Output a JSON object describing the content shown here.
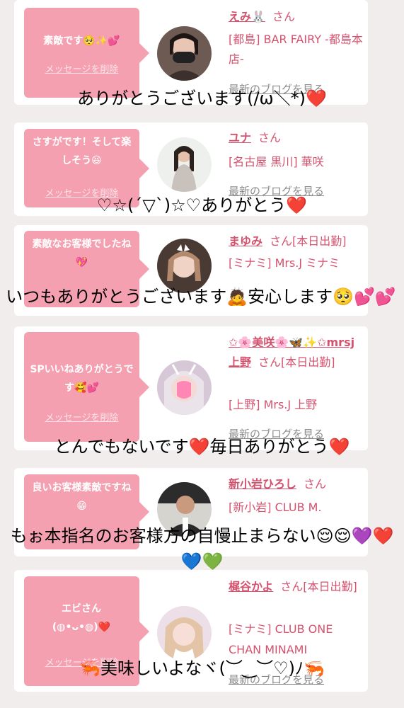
{
  "cards": [
    {
      "message": "素敵です🥺✨💕",
      "delete_label": "メッセージを削除",
      "name": "えみ🐰",
      "honorific": "さん",
      "shop": "[都島] BAR FAIRY -都島本店-",
      "blog_label": "最新のブログを見る"
    },
    {
      "message": "さすがです！そして楽しそう😆",
      "delete_label": "メッセージを削除",
      "name": "ユナ",
      "honorific": "さん",
      "shop": "[名古屋 黒川] 華咲",
      "blog_label": "最新のブログを見る"
    },
    {
      "message": "素敵なお客様でしたね💖",
      "delete_label": "メッセージを削除",
      "name": "まゆみ",
      "honorific": "さん[本日出勤]",
      "shop": "[ミナミ] Mrs.J ミナミ",
      "blog_label": "最新のブログを見る"
    },
    {
      "message": "SPいいねありがとうです🥰💕",
      "delete_label": "メッセージを削除",
      "name": "✩🌸美咲🌸🦋✨✩mrsj上野",
      "honorific": "さん[本日出勤]",
      "shop": "[上野] Mrs.J 上野",
      "blog_label": "最新のブログを見る"
    },
    {
      "message": "良いお客様素敵ですね😁",
      "delete_label": "メッセージを削除",
      "name": "新小岩ひろし",
      "honorific": "さん",
      "shop": "[新小岩] CLUB M.",
      "blog_label": "最新のブログを見る"
    },
    {
      "message": "エビさん(◍•ᴗ•◍)❤️",
      "delete_label": "メッセージを削除",
      "name": "梶谷かよ",
      "honorific": "さん[本日出勤]",
      "shop": "[ミナミ] CLUB ONE CHAN MINAMI",
      "blog_label": "最新のブログを見る"
    }
  ],
  "captions": [
    "ありがとうございます(/ω＼*)❤️",
    "♡☆(´▽`)☆♡ありがとう❤️",
    "いつもありがとうございます🙇安心します🥺💕💕",
    "とんでもないです❤️毎日ありがとう❤️",
    "もぉ本指名のお客様方の自慢止まらない😌😌💜❤️💙💚",
    "🦐美味しいよなヾ(︶‿︶♡)ﾉ🦐"
  ],
  "theme": {
    "background": "#f1eded",
    "bubble": "#f5a0b0",
    "name_color": "#d4526e",
    "blog_color": "#8c8c8c"
  }
}
